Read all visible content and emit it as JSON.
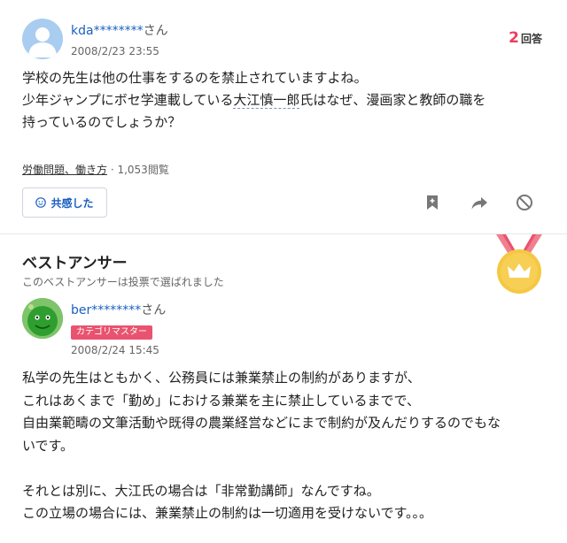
{
  "question": {
    "user_name": "kda********",
    "user_suffix": "さん",
    "date": "2008/2/23 23:55",
    "answers_count": "2",
    "answers_label": "回答",
    "body_line1": "学校の先生は他の仕事をするのを禁止されていますよね。",
    "body_line2_before": "少年ジャンプにボセ学連載している",
    "body_line2_link": "大江慎一郎",
    "body_line2_after": "氏はなぜ、漫画家と教師の職を",
    "body_line3": "持っているのでしょうか？",
    "category": "労働問題、働き方",
    "views": " · 1,053閲覧",
    "empathy_label": "共感した",
    "icons": {
      "bookmark": "bookmark-icon",
      "share": "share-icon",
      "report": "block-icon"
    }
  },
  "best_answer": {
    "title": "ベストアンサー",
    "subtitle": "このベストアンサーは投票で選ばれました",
    "user_name": "ber********",
    "user_suffix": "さん",
    "badge": "カテゴリマスター",
    "date": "2008/2/24 15:45",
    "body": [
      "私学の先生はともかく、公務員には兼業禁止の制約がありますが、",
      "これはあくまで「勤め」における兼業を主に禁止しているまでで、",
      "自由業範疇の文筆活動や既得の農業経営などにまで制約が及んだりするのでもな",
      "いです。",
      "",
      "それとは別に、大江氏の場合は「非常勤講師」なんですね。",
      "この立場の場合には、兼業禁止の制約は一切適用を受けないです。。。"
    ]
  },
  "colors": {
    "link": "#1a5fc1",
    "accent": "#f03c5c",
    "badge": "#e9536f",
    "medal": "#f5c842"
  }
}
